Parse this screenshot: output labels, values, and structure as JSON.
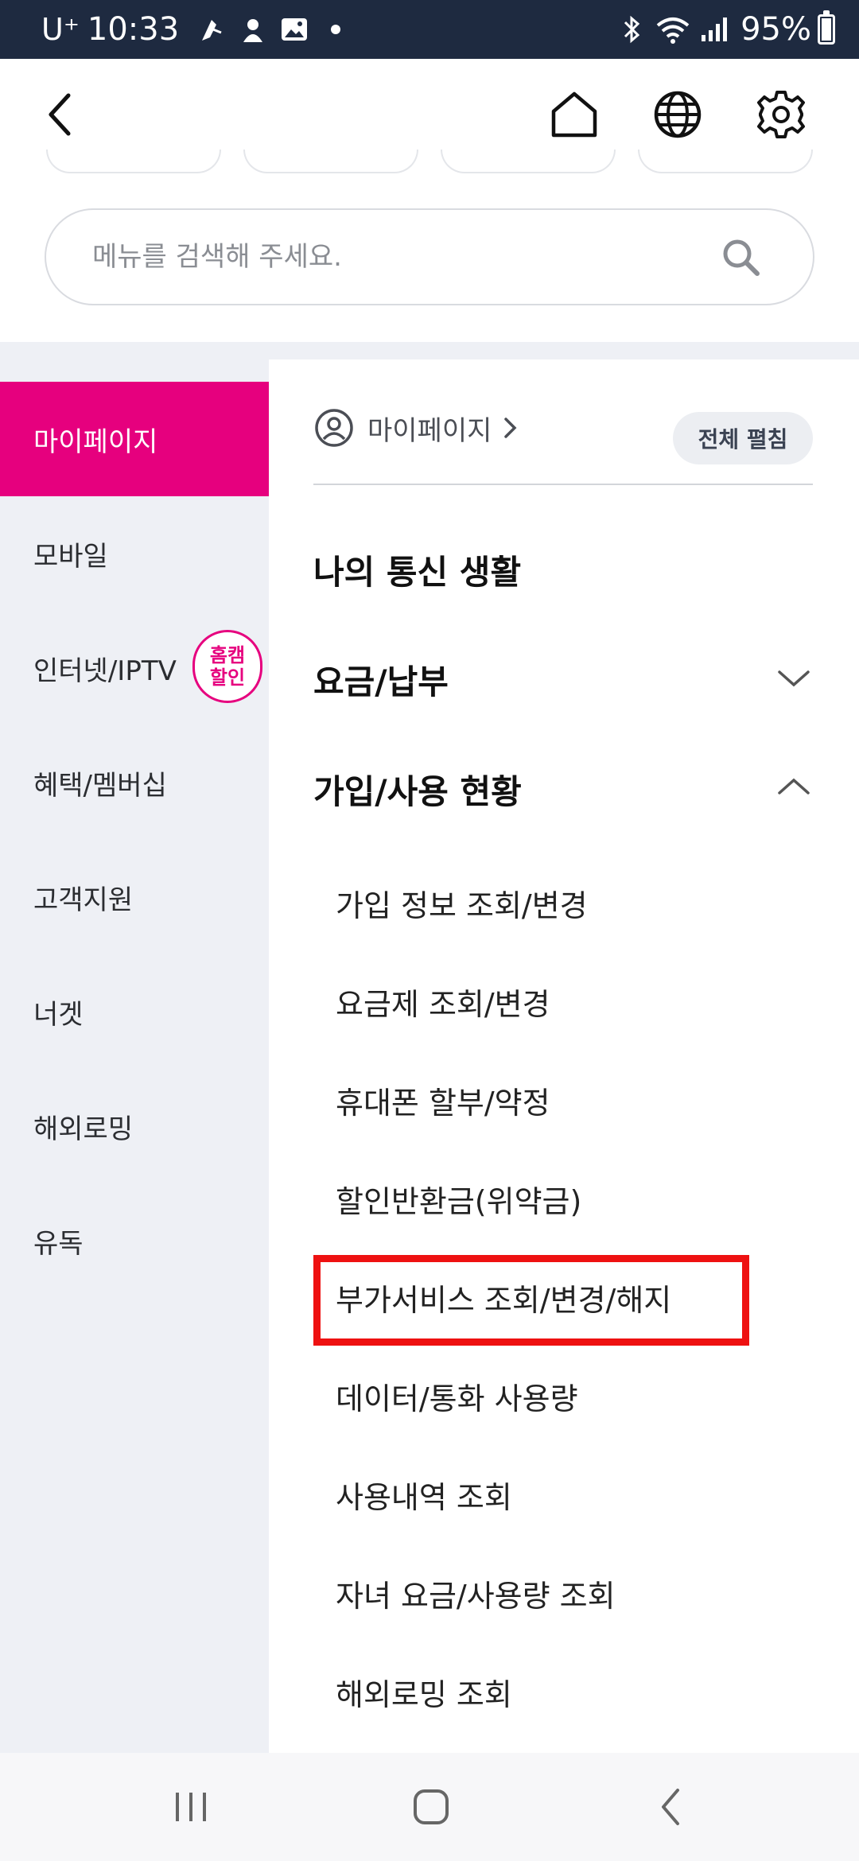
{
  "status_bar": {
    "carrier": "U⁺",
    "time": "10:33",
    "battery": "95%",
    "battery_level": 0.95
  },
  "search": {
    "placeholder": "메뉴를 검색해 주세요."
  },
  "left_nav": {
    "items": [
      {
        "label": "마이페이지",
        "active": true
      },
      {
        "label": "모바일"
      },
      {
        "label": "인터넷/IPTV",
        "badge": "홈캠\n할인"
      },
      {
        "label": "혜택/멤버십"
      },
      {
        "label": "고객지원"
      },
      {
        "label": "너겟"
      },
      {
        "label": "해외로밍"
      },
      {
        "label": "유독"
      }
    ]
  },
  "content": {
    "breadcrumb": "마이페이지",
    "expand_all": "전체 펼침",
    "sections": [
      {
        "title": "나의 통신 생활"
      },
      {
        "title": "요금/납부",
        "state": "collapsed"
      },
      {
        "title": "가입/사용 현황",
        "state": "expanded"
      }
    ],
    "sub_items": [
      "가입 정보 조회/변경",
      "요금제 조회/변경",
      "휴대폰 할부/약정",
      "할인반환금(위약금)",
      "부가서비스 조회/변경/해지",
      "데이터/통화 사용량",
      "사용내역 조회",
      "자녀 요금/사용량 조회",
      "해외로밍 조회"
    ]
  },
  "colors": {
    "accent": "#e6007e",
    "statusbar": "#1e2a40",
    "nav_bg": "#eef0f5",
    "highlight": "#ee1111"
  }
}
